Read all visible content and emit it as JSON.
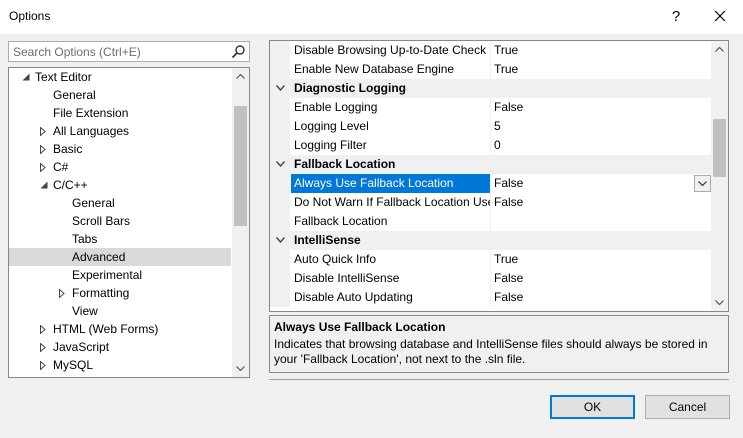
{
  "window": {
    "title": "Options",
    "help": "?",
    "close_icon": "close-icon"
  },
  "search": {
    "placeholder": "Search Options (Ctrl+E)",
    "value": "",
    "icon": "search-icon"
  },
  "tree": {
    "items": [
      {
        "label": "Text Editor",
        "level": 0,
        "arrow": "expanded",
        "selected": false
      },
      {
        "label": "General",
        "level": 1,
        "arrow": "none",
        "selected": false
      },
      {
        "label": "File Extension",
        "level": 1,
        "arrow": "none",
        "selected": false
      },
      {
        "label": "All Languages",
        "level": 1,
        "arrow": "collapsed",
        "selected": false
      },
      {
        "label": "Basic",
        "level": 1,
        "arrow": "collapsed",
        "selected": false
      },
      {
        "label": "C#",
        "level": 1,
        "arrow": "collapsed",
        "selected": false
      },
      {
        "label": "C/C++",
        "level": 1,
        "arrow": "expanded",
        "selected": false
      },
      {
        "label": "General",
        "level": 2,
        "arrow": "none",
        "selected": false
      },
      {
        "label": "Scroll Bars",
        "level": 2,
        "arrow": "none",
        "selected": false
      },
      {
        "label": "Tabs",
        "level": 2,
        "arrow": "none",
        "selected": false
      },
      {
        "label": "Advanced",
        "level": 2,
        "arrow": "none",
        "selected": true
      },
      {
        "label": "Experimental",
        "level": 2,
        "arrow": "none",
        "selected": false
      },
      {
        "label": "Formatting",
        "level": 2,
        "arrow": "collapsed",
        "selected": false
      },
      {
        "label": "View",
        "level": 2,
        "arrow": "none",
        "selected": false
      },
      {
        "label": "HTML (Web Forms)",
        "level": 1,
        "arrow": "collapsed",
        "selected": false
      },
      {
        "label": "JavaScript",
        "level": 1,
        "arrow": "collapsed",
        "selected": false
      },
      {
        "label": "MySQL",
        "level": 1,
        "arrow": "collapsed",
        "selected": false
      }
    ]
  },
  "grid": {
    "rows": [
      {
        "type": "prop",
        "name": "Disable Browsing Up-to-Date Check",
        "value": "True"
      },
      {
        "type": "prop",
        "name": "Enable New Database Engine",
        "value": "True"
      },
      {
        "type": "cat",
        "name": "Diagnostic Logging"
      },
      {
        "type": "prop",
        "name": "Enable Logging",
        "value": "False"
      },
      {
        "type": "prop",
        "name": "Logging Level",
        "value": "5"
      },
      {
        "type": "prop",
        "name": "Logging Filter",
        "value": "0"
      },
      {
        "type": "cat",
        "name": "Fallback Location"
      },
      {
        "type": "prop",
        "name": "Always Use Fallback Location",
        "value": "False",
        "selected": true
      },
      {
        "type": "prop",
        "name": "Do Not Warn If Fallback Location Used",
        "value": "False"
      },
      {
        "type": "prop",
        "name": "Fallback Location",
        "value": ""
      },
      {
        "type": "cat",
        "name": "IntelliSense"
      },
      {
        "type": "prop",
        "name": "Auto Quick Info",
        "value": "True"
      },
      {
        "type": "prop",
        "name": "Disable IntelliSense",
        "value": "False"
      },
      {
        "type": "prop",
        "name": "Disable Auto Updating",
        "value": "False"
      }
    ]
  },
  "description": {
    "title": "Always Use Fallback Location",
    "text": "Indicates that browsing database and IntelliSense files should always be stored in your 'Fallback Location', not next to the .sln file."
  },
  "buttons": {
    "ok": "OK",
    "cancel": "Cancel"
  },
  "colors": {
    "selection": "#0078d7",
    "tree_selection": "#d9d9d9",
    "category_bg": "#f0f0f0"
  }
}
